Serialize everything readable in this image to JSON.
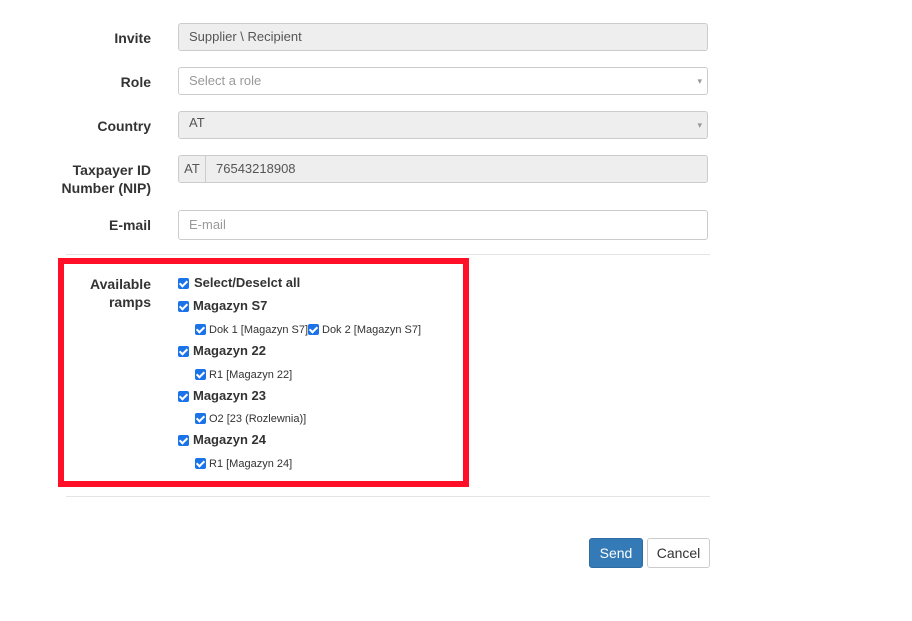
{
  "form": {
    "invite": {
      "label": "Invite",
      "value": "Supplier \\ Recipient"
    },
    "role": {
      "label": "Role",
      "placeholder": "Select a role",
      "caret": "▾"
    },
    "country": {
      "label": "Country",
      "value": "AT",
      "caret": "▾"
    },
    "nip": {
      "label_line1": "Taxpayer ID",
      "label_line2": "Number (NIP)",
      "prefix": "AT",
      "value": "76543218908"
    },
    "email": {
      "label": "E-mail",
      "placeholder": "E-mail"
    }
  },
  "ramps": {
    "label_line1": "Available",
    "label_line2": "ramps",
    "select_all": "Select/Deselct all",
    "groups": [
      {
        "name": "Magazyn S7",
        "items": [
          "Dok 1 [Magazyn S7]",
          "Dok 2 [Magazyn S7]"
        ]
      },
      {
        "name": "Magazyn 22",
        "items": [
          "R1 [Magazyn 22]"
        ]
      },
      {
        "name": "Magazyn 23",
        "items": [
          "O2 [23 (Rozlewnia)]"
        ]
      },
      {
        "name": "Magazyn 24",
        "items": [
          "R1 [Magazyn 24]"
        ]
      }
    ]
  },
  "buttons": {
    "send": "Send",
    "cancel": "Cancel"
  },
  "colors": {
    "highlight_box": "#ff1028",
    "checkbox": "#1a73e8",
    "primary_button": "#337ab7"
  }
}
